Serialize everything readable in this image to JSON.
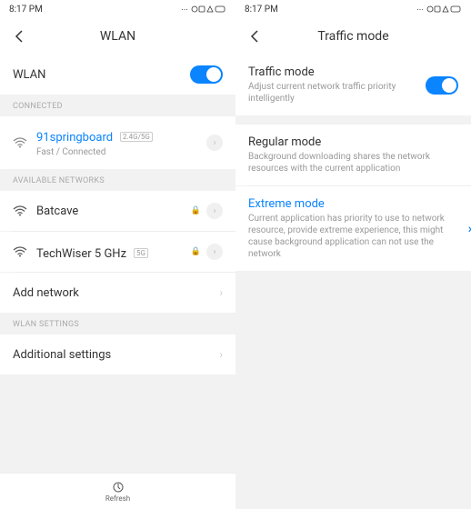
{
  "status": {
    "time": "8:17 PM",
    "icons": "⋯ ⌀ ⏏ ⛉ ⚡"
  },
  "left": {
    "title": "WLAN",
    "wlan_toggle_label": "WLAN",
    "connected_header": "CONNECTED",
    "connected": {
      "name": "91springboard",
      "badge": "2.4G/5G",
      "status": "Fast / Connected"
    },
    "available_header": "AVAILABLE NETWORKS",
    "networks": [
      {
        "name": "Batcave",
        "badge": ""
      },
      {
        "name": "TechWiser 5 GHz",
        "badge": "5G"
      }
    ],
    "add_network": "Add network",
    "settings_header": "WLAN SETTINGS",
    "additional": "Additional settings",
    "refresh": "Refresh"
  },
  "right": {
    "title": "Traffic mode",
    "traffic": {
      "title": "Traffic mode",
      "sub": "Adjust current network traffic priority intelligently"
    },
    "regular": {
      "title": "Regular mode",
      "sub": "Background downloading shares the network resources with the current application"
    },
    "extreme": {
      "title": "Extreme mode",
      "sub": "Current application has priority to use to network resource, provide extreme experience, this might cause background application can not use the network"
    }
  }
}
